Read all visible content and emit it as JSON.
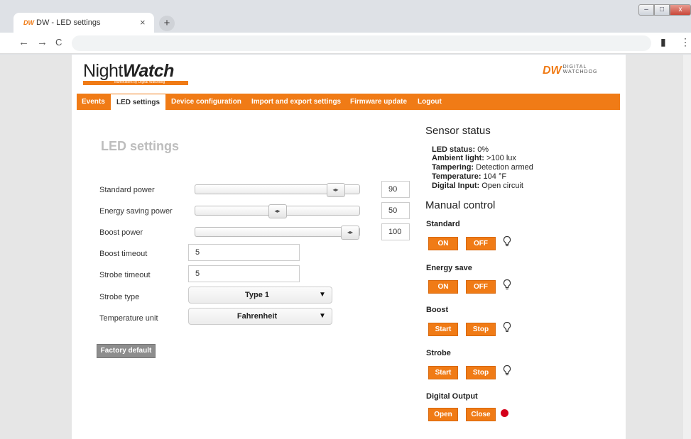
{
  "browser": {
    "tab_logo": "DW",
    "tab_title": "DW - LED settings",
    "tab_close": "×",
    "new_tab": "+",
    "win_min": "‒",
    "win_max": "□",
    "win_close": "x",
    "back": "←",
    "forward": "→",
    "reload": "C",
    "ext": "▮",
    "menu": "⋮"
  },
  "header": {
    "logo_light": "Night",
    "logo_bold": "Watch",
    "logo_tagline": "Illuminators by Digital Watchdog",
    "brand_mark": "DW",
    "brand_line1": "DIGITAL",
    "brand_line2": "WATCHDOG"
  },
  "menu": {
    "items": [
      "Events",
      "LED settings",
      "Device configuration",
      "Import and export settings",
      "Firmware update",
      "Logout"
    ],
    "active": "LED settings"
  },
  "form": {
    "title": "LED settings",
    "standard_power": {
      "label": "Standard power",
      "value": "90",
      "level": 90
    },
    "energy_power": {
      "label": "Energy saving power",
      "value": "50",
      "level": 50
    },
    "boost_power": {
      "label": "Boost power",
      "value": "100",
      "level": 100
    },
    "slider_glyph": "◂▸",
    "boost_timeout": {
      "label": "Boost timeout",
      "value": "5"
    },
    "strobe_timeout": {
      "label": "Strobe timeout",
      "value": "5"
    },
    "strobe_type": {
      "label": "Strobe type",
      "value": "Type 1"
    },
    "temp_unit": {
      "label": "Temperature unit",
      "value": "Fahrenheit"
    },
    "caret": "▼",
    "factory_default": "Factory default"
  },
  "sensor": {
    "title": "Sensor status",
    "led_status": {
      "key": "LED status:",
      "value": "0%"
    },
    "ambient": {
      "key": "Ambient light:",
      "value": ">100 lux"
    },
    "tampering": {
      "key": "Tampering:",
      "value": "Detection armed"
    },
    "temperature": {
      "key": "Temperature:",
      "value": "104 °F"
    },
    "digital_input": {
      "key": "Digital Input:",
      "value": "Open circuit"
    }
  },
  "manual": {
    "title": "Manual control",
    "standard": {
      "label": "Standard",
      "on": "ON",
      "off": "OFF"
    },
    "energy": {
      "label": "Energy save",
      "on": "ON",
      "off": "OFF"
    },
    "boost": {
      "label": "Boost",
      "start": "Start",
      "stop": "Stop"
    },
    "strobe": {
      "label": "Strobe",
      "start": "Start",
      "stop": "Stop"
    },
    "digital_output": {
      "label": "Digital Output",
      "open": "Open",
      "close": "Close"
    }
  },
  "colors": {
    "accent": "#f07b16",
    "indicator": "#d4001a",
    "title_gray": "#bdbdbd"
  },
  "icons": {
    "bulb": "bulb-icon",
    "output_indicator": "red-dot-icon"
  }
}
